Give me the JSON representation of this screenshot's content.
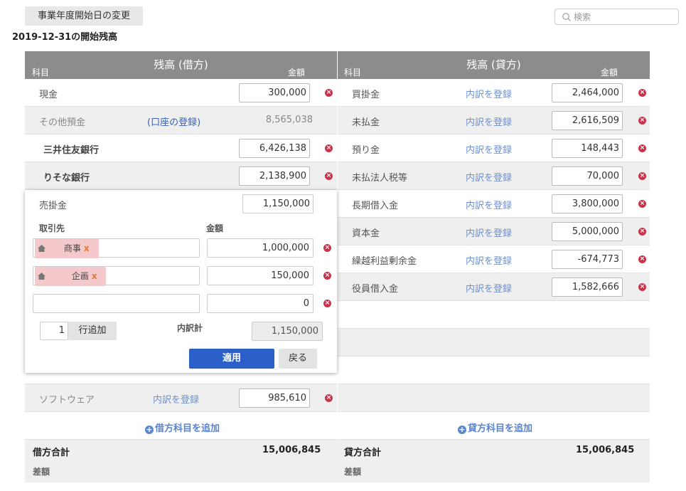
{
  "header": {
    "change_button": "事業年度開始日の変更",
    "search_placeholder": "検索",
    "page_title": "2019-12-31の開始残高"
  },
  "debit": {
    "title": "残高 (借方)",
    "col_account": "科目",
    "col_amount": "金額",
    "rows": [
      {
        "account": "現金",
        "amount": "300,000"
      },
      {
        "account": "その他預金",
        "link": "(口座の登録)",
        "amount": "8,565,038"
      },
      {
        "account": "三井住友銀行",
        "amount": "6,426,138"
      },
      {
        "account": "りそな銀行",
        "amount": "2,138,900"
      },
      {
        "account": "ソフトウェア",
        "link": "内訳を登録",
        "amount": "985,610"
      }
    ],
    "add_label": "借方科目を追加",
    "total_label": "借方合計",
    "total_value": "15,006,845",
    "diff_label": "差額"
  },
  "credit": {
    "title": "残高 (貸方)",
    "col_account": "科目",
    "col_amount": "金額",
    "rows": [
      {
        "account": "買掛金",
        "link": "内訳を登録",
        "amount": "2,464,000"
      },
      {
        "account": "未払金",
        "link": "内訳を登録",
        "amount": "2,616,509"
      },
      {
        "account": "預り金",
        "link": "内訳を登録",
        "amount": "148,443"
      },
      {
        "account": "未払法人税等",
        "link": "内訳を登録",
        "amount": "70,000"
      },
      {
        "account": "長期借入金",
        "link": "内訳を登録",
        "amount": "3,800,000"
      },
      {
        "account": "資本金",
        "link": "内訳を登録",
        "amount": "5,000,000"
      },
      {
        "account": "繰越利益剰余金",
        "link": "内訳を登録",
        "amount": "-674,773"
      },
      {
        "account": "役員借入金",
        "link": "内訳を登録",
        "amount": "1,582,666"
      }
    ],
    "add_label": "貸方科目を追加",
    "total_label": "貸方合計",
    "total_value": "15,006,845",
    "diff_label": "差額"
  },
  "popup": {
    "account": "売掛金",
    "amount": "1,150,000",
    "col_partner": "取引先",
    "col_amount": "金額",
    "lines": [
      {
        "partner": "商事",
        "amount": "1,000,000"
      },
      {
        "partner": "企画",
        "amount": "150,000"
      },
      {
        "partner": "",
        "amount": "0"
      }
    ],
    "row_count": "1",
    "add_row_label": "行追加",
    "subtotal_label": "内訳計",
    "subtotal_value": "1,150,000",
    "apply_label": "適用",
    "back_label": "戻る"
  },
  "colors": {
    "header_bg": "#8c8c8c",
    "accent": "#2b5fc7",
    "delete": "#c9344a",
    "link": "#6d8fd0"
  }
}
